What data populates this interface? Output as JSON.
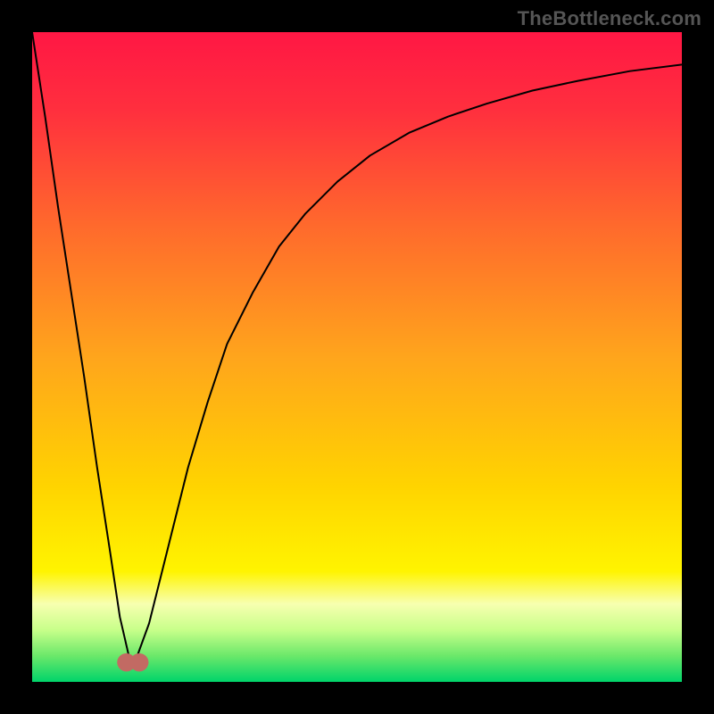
{
  "attribution": "TheBottleneck.com",
  "chart_data": {
    "type": "line",
    "title": "",
    "xlabel": "",
    "ylabel": "",
    "xlim": [
      0,
      100
    ],
    "ylim": [
      0,
      100
    ],
    "background": {
      "stops": [
        {
          "offset": 0.0,
          "color": "#ff1744"
        },
        {
          "offset": 0.12,
          "color": "#ff2f3e"
        },
        {
          "offset": 0.3,
          "color": "#ff6a2c"
        },
        {
          "offset": 0.5,
          "color": "#ffa51c"
        },
        {
          "offset": 0.7,
          "color": "#ffd400"
        },
        {
          "offset": 0.83,
          "color": "#fff400"
        },
        {
          "offset": 0.88,
          "color": "#f7ffb0"
        },
        {
          "offset": 0.92,
          "color": "#c8ff8a"
        },
        {
          "offset": 0.96,
          "color": "#6be86a"
        },
        {
          "offset": 1.0,
          "color": "#00d46a"
        }
      ]
    },
    "series": [
      {
        "name": "curve",
        "color": "#000000",
        "width": 2,
        "x": [
          0,
          2,
          4,
          6,
          8,
          10,
          12,
          13.5,
          15,
          16,
          18,
          21,
          24,
          27,
          30,
          34,
          38,
          42,
          47,
          52,
          58,
          64,
          70,
          77,
          84,
          92,
          100
        ],
        "y": [
          100,
          87,
          73,
          60,
          47,
          33,
          20,
          10,
          3.5,
          3.5,
          9,
          21,
          33,
          43,
          52,
          60,
          67,
          72,
          77,
          81,
          84.5,
          87,
          89,
          91,
          92.5,
          94,
          95
        ]
      }
    ],
    "marker": {
      "name": "trough-marker",
      "color": "#c26a63",
      "cx": 15.5,
      "cy": 3.0,
      "rx": 2.2,
      "ry": 1.4
    }
  }
}
